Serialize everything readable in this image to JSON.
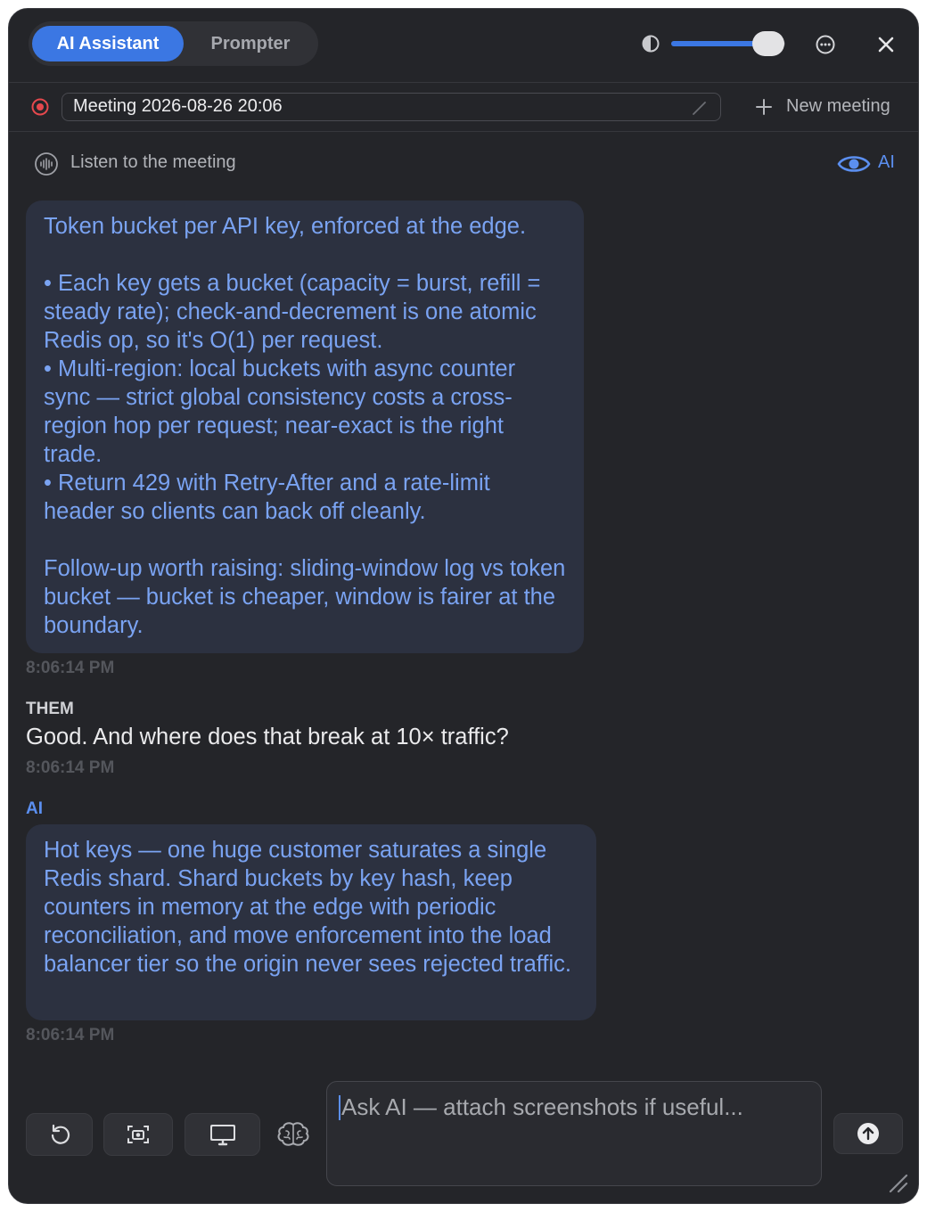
{
  "tabs": {
    "ai_assistant": "AI Assistant",
    "prompter": "Prompter"
  },
  "opacity": {
    "icon": "contrast-icon",
    "value_fraction": 0.82
  },
  "meeting": {
    "title": "Meeting 2026-08-26 20:06",
    "new_meeting_label": "New meeting"
  },
  "listen": {
    "label": "Listen to the meeting",
    "ai_toggle_label": "AI"
  },
  "messages": [
    {
      "role": "ai",
      "text": "Token bucket per API key, enforced at the edge.\n\n• Each key gets a bucket (capacity = burst, refill = steady rate); check-and-decrement is one atomic Redis op, so it's O(1) per request.\n• Multi-region: local buckets with async counter sync — strict global consistency costs a cross-region hop per request; near-exact is the right trade.\n• Return 429 with Retry-After and a rate-limit header so clients can back off cleanly.\n\nFollow-up worth raising: sliding-window log vs token bucket — bucket is cheaper, window is fairer at the boundary.",
      "time": "8:06:14 PM"
    },
    {
      "role": "them",
      "speaker": "THEM",
      "text": "Good. And where does that break at 10× traffic?",
      "time": "8:06:14 PM"
    },
    {
      "role": "ai",
      "speaker": "AI",
      "text": "Hot keys — one huge customer saturates a single Redis shard. Shard buckets by key hash, keep counters in memory at the edge with periodic reconciliation, and move enforcement into the load balancer tier so the origin never sees rejected traffic.",
      "time": "8:06:14 PM"
    }
  ],
  "input": {
    "placeholder": "Ask AI — attach screenshots if useful..."
  },
  "toolbar": {
    "icons": [
      "refresh-icon",
      "screenshot-icon",
      "screen-share-icon",
      "brain-icon",
      "send-icon"
    ]
  },
  "colors": {
    "accent": "#3b77e3",
    "ai_text": "#7aa3f2",
    "record": "#e5484d",
    "window_bg": "#242529"
  }
}
